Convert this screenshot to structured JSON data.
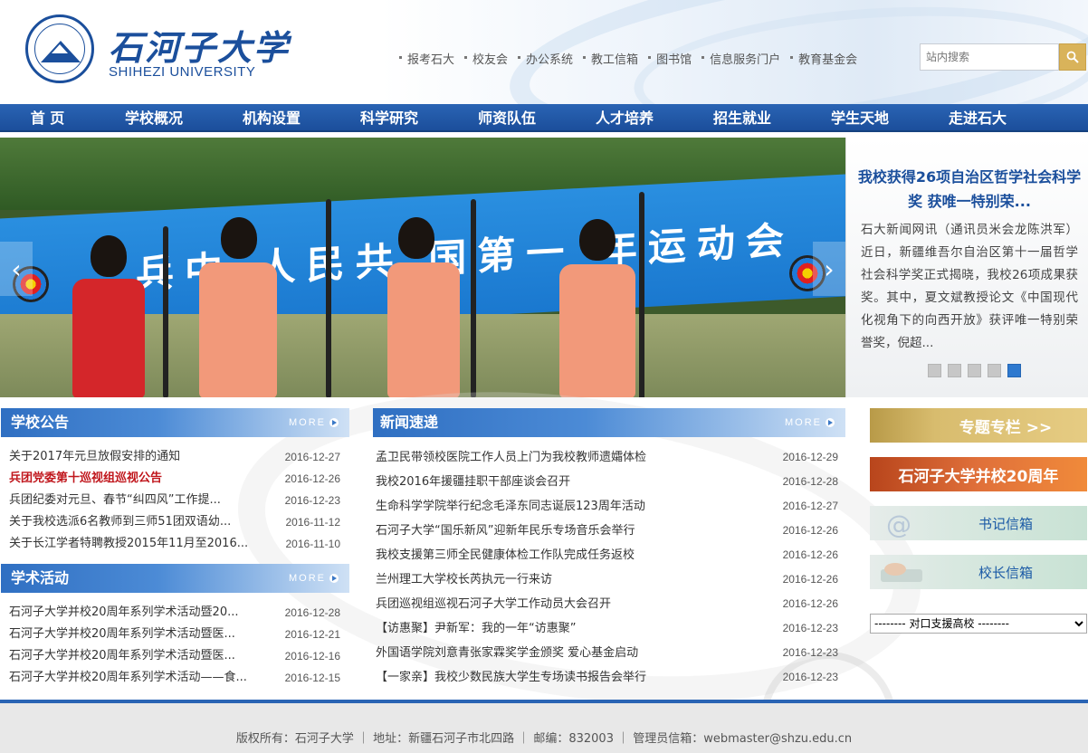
{
  "header": {
    "logo_cn": "石河子大学",
    "logo_en": "SHIHEZI UNIVERSITY",
    "top_links": [
      "报考石大",
      "校友会",
      "办公系统",
      "教工信箱",
      "图书馆",
      "信息服务门户",
      "教育基金会"
    ],
    "search": {
      "placeholder": "站内搜索"
    }
  },
  "nav": {
    "items": [
      "首 页",
      "学校概况",
      "机构设置",
      "科学研究",
      "师资队伍",
      "人才培养",
      "招生就业",
      "学生天地",
      "走进石大"
    ]
  },
  "banner": {
    "board_text": "兵中 人民共 国第一 年运动会"
  },
  "feature": {
    "title": "我校获得26项自治区哲学社会科学奖 获唯一特别荣...",
    "summary": "石大新闻网讯（通讯员米会龙陈洪军）近日，新疆维吾尔自治区第十一届哲学社会科学奖正式揭晓，我校26项成果获奖。其中，夏文斌教授论文《中国现代化视角下的向西开放》获评唯一特别荣誉奖，倪超...",
    "slide_count": 5,
    "active_slide": 5
  },
  "announcements": {
    "title": "学校公告",
    "more": "MORE",
    "items": [
      {
        "text": "关于2017年元旦放假安排的通知",
        "date": "2016-12-27",
        "highlight": false
      },
      {
        "text": "兵团党委第十巡视组巡视公告",
        "date": "2016-12-26",
        "highlight": true
      },
      {
        "text": "兵团纪委对元旦、春节“纠四风”工作提...",
        "date": "2016-12-23",
        "highlight": false
      },
      {
        "text": "关于我校选派6名教师到三师51团双语幼...",
        "date": "2016-11-12",
        "highlight": false
      },
      {
        "text": "关于长江学者特聘教授2015年11月至2016...",
        "date": "2016-11-10",
        "highlight": false
      }
    ]
  },
  "academic": {
    "title": "学术活动",
    "more": "MORE",
    "items": [
      {
        "text": "石河子大学并校20周年系列学术活动暨20...",
        "date": "2016-12-28"
      },
      {
        "text": "石河子大学并校20周年系列学术活动暨医...",
        "date": "2016-12-21"
      },
      {
        "text": "石河子大学并校20周年系列学术活动暨医...",
        "date": "2016-12-16"
      },
      {
        "text": "石河子大学并校20周年系列学术活动——食...",
        "date": "2016-12-15"
      }
    ]
  },
  "news": {
    "title": "新闻速递",
    "more": "MORE",
    "items": [
      {
        "text": "孟卫民带领校医院工作人员上门为我校教师遗孀体检",
        "date": "2016-12-29"
      },
      {
        "text": "我校2016年援疆挂职干部座谈会召开",
        "date": "2016-12-28"
      },
      {
        "text": "生命科学学院举行纪念毛泽东同志诞辰123周年活动",
        "date": "2016-12-27"
      },
      {
        "text": "石河子大学“国乐新风”迎新年民乐专场音乐会举行",
        "date": "2016-12-26"
      },
      {
        "text": "我校支援第三师全民健康体检工作队完成任务返校",
        "date": "2016-12-26"
      },
      {
        "text": "兰州理工大学校长芮执元一行来访",
        "date": "2016-12-26"
      },
      {
        "text": "兵团巡视组巡视石河子大学工作动员大会召开",
        "date": "2016-12-26"
      },
      {
        "text": "【访惠聚】尹新军：我的一年“访惠聚”",
        "date": "2016-12-23"
      },
      {
        "text": "外国语学院刘意青张家霖奖学金颁奖 爱心基金启动",
        "date": "2016-12-23"
      },
      {
        "text": "【一家亲】我校少数民族大学生专场读书报告会举行",
        "date": "2016-12-23"
      }
    ]
  },
  "sidebar": {
    "topic": "专题专栏 >>",
    "anniversary": "石河子大学并校20周年",
    "secretary_mail": "书记信箱",
    "president_mail": "校长信箱",
    "support_select": "-------- 对口支援高校 --------"
  },
  "footer": {
    "text": "版权所有：石河子大学 ｜ 地址：新疆石河子市北四路 ｜ 邮编：832003 ｜ 管理员信箱：webmaster@shzu.edu.cn"
  },
  "colors": {
    "brand_blue": "#1b4f9c",
    "nav_blue": "#2a64b4",
    "highlight_red": "#c0161c",
    "gold": "#d9b35a"
  }
}
